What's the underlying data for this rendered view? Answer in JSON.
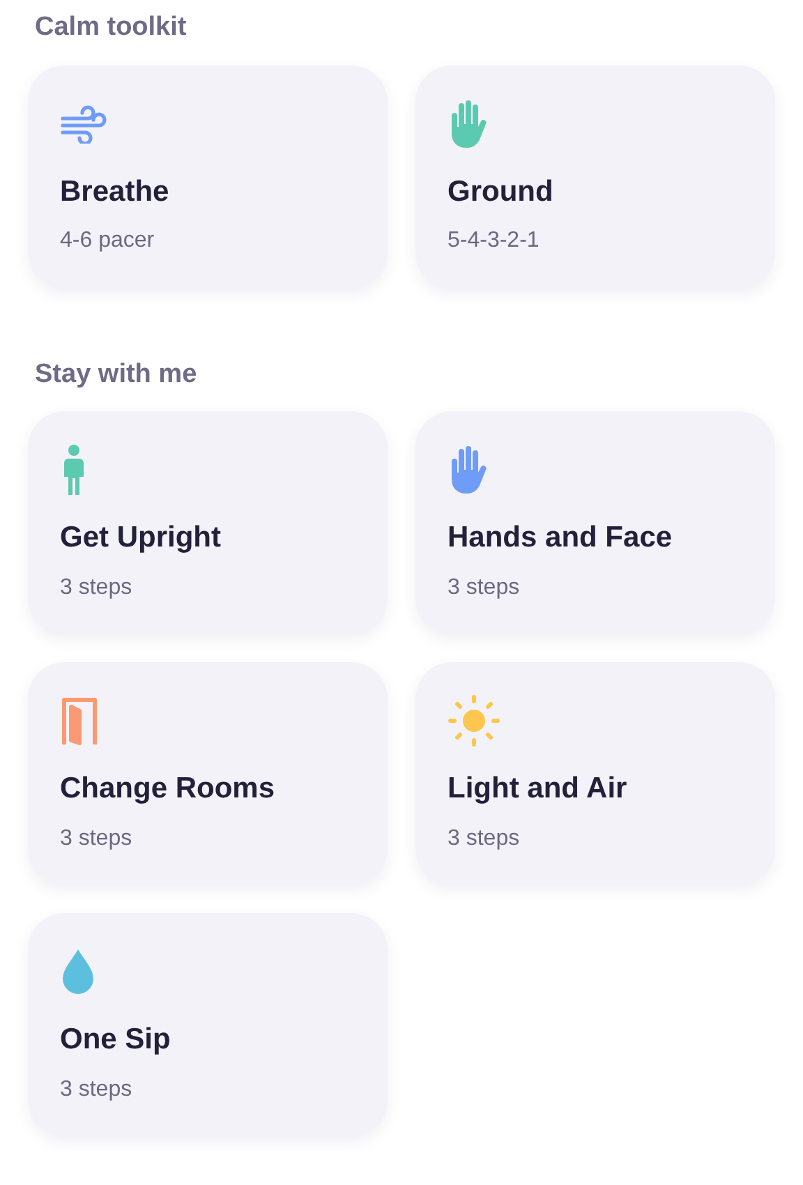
{
  "sections": [
    {
      "title": "Calm toolkit",
      "cards": [
        {
          "title": "Breathe",
          "subtitle": "4-6 pacer"
        },
        {
          "title": "Ground",
          "subtitle": "5-4-3-2-1"
        }
      ]
    },
    {
      "title": "Stay with me",
      "cards": [
        {
          "title": "Get Upright",
          "subtitle": "3 steps"
        },
        {
          "title": "Hands and Face",
          "subtitle": "3 steps"
        },
        {
          "title": "Change Rooms",
          "subtitle": "3 steps"
        },
        {
          "title": "Light and Air",
          "subtitle": "3 steps"
        },
        {
          "title": "One Sip",
          "subtitle": "3 steps"
        }
      ]
    }
  ]
}
